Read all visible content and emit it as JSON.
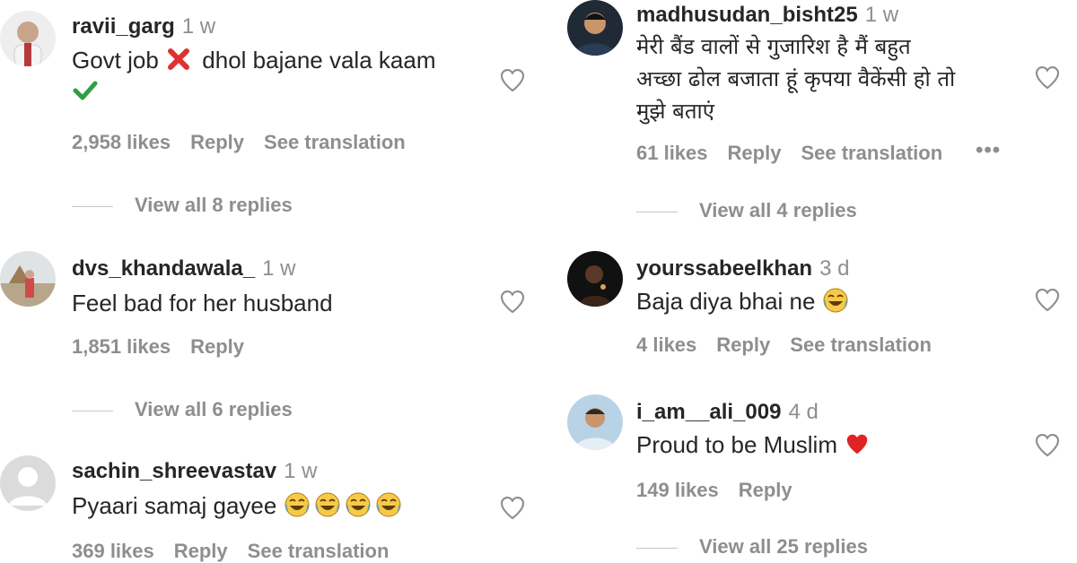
{
  "left": {
    "comments": [
      {
        "username": "ravii_garg",
        "time": "1 w",
        "text_part1": "Govt job",
        "text_part2": "dhol bajane vala kaam",
        "likes": "2,958 likes",
        "reply": "Reply",
        "translate": "See translation",
        "replies": "View all 8 replies"
      },
      {
        "username": "dvs_khandawala_",
        "time": "1 w",
        "text": "Feel bad for her husband",
        "likes": "1,851 likes",
        "reply": "Reply",
        "replies": "View all 6 replies"
      },
      {
        "username": "sachin_shreevastav",
        "time": "1 w",
        "text": "Pyaari samaj gayee",
        "likes": "369 likes",
        "reply": "Reply",
        "translate": "See translation"
      }
    ]
  },
  "right": {
    "comments": [
      {
        "username": "madhusudan_bisht25",
        "time": "1 w",
        "text_line1": "मेरी बैंड वालों से गुजारिश है मैं बहुत",
        "text_line2": "अच्छा ढोल बजाता हूं कृपया वैकेंसी हो तो",
        "text_line3": "मुझे बताएं",
        "likes": "61 likes",
        "reply": "Reply",
        "translate": "See translation",
        "more": "•••",
        "replies": "View all 4 replies"
      },
      {
        "username": "yourssabeelkhan",
        "time": "3 d",
        "text": "Baja diya bhai ne",
        "likes": "4 likes",
        "reply": "Reply",
        "translate": "See translation"
      },
      {
        "username": "i_am__ali_009",
        "time": "4 d",
        "text": "Proud to be Muslim",
        "likes": "149 likes",
        "reply": "Reply",
        "replies": "View all 25 replies"
      }
    ]
  },
  "colors": {
    "text": "#262626",
    "secondary": "#8e8e8e",
    "cross_mark": "#e03131",
    "check_mark": "#2f9e44",
    "heart_emoji": "#e02424"
  },
  "icons": [
    "heart-outline-icon",
    "cross-mark-emoji",
    "check-mark-emoji",
    "laughing-tears-emoji",
    "red-heart-emoji",
    "more-options-icon"
  ]
}
